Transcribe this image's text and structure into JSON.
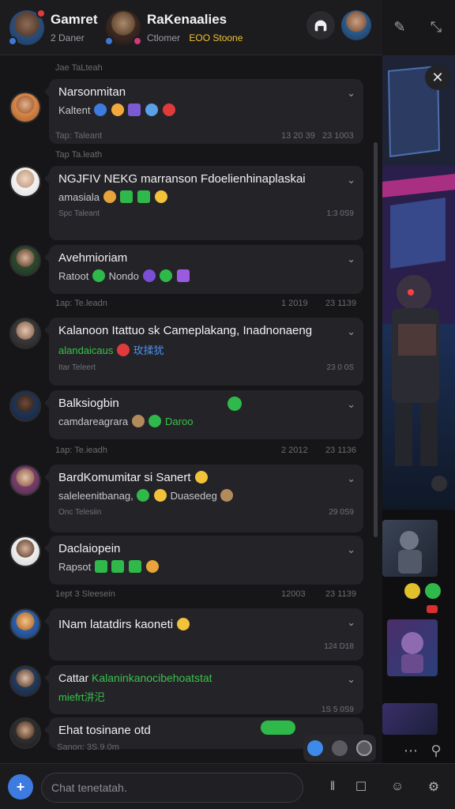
{
  "header": {
    "profile1": {
      "name": "Gamret",
      "sub": "2 Daner"
    },
    "profile2": {
      "name": "RaKenaalies",
      "sub": "Ctlomer",
      "highlight": "ЕОО Stoone"
    }
  },
  "messages": [
    {
      "title": "Narsonmitan",
      "line": "Kaltent",
      "meta_left": "",
      "meta_right": ""
    },
    {
      "title": "NGJFIV NEKG marranson Fdoelienhinaplaskai",
      "line": "amasiala",
      "meta_left": "Spc Taleant",
      "meta_right": "1:3 0S9"
    },
    {
      "title": "Avehmioriam",
      "line": "Ratoot",
      "line_suffix": "Nondo",
      "meta_left": "",
      "meta_right": ""
    },
    {
      "title": "Kalanoon Itattuo sk Cameplakang, Inadnonaeng",
      "line": "alandaicaus",
      "line_suffix": "玫揉犹",
      "meta_left": "Itar Teleert",
      "meta_right": "23 0 0S"
    },
    {
      "title": "Balksiogbin",
      "line": "camdareagrara",
      "line_suffix": "Daroo",
      "meta_left": "",
      "meta_right": ""
    },
    {
      "title": "BardKomumitar si Sanert",
      "line": "saleleenitbanag,",
      "line_suffix": "Duasedeg",
      "meta_left": "Onc Telesiin",
      "meta_right": "29 0S9"
    },
    {
      "title": "Daclaiopein",
      "line": "Rapsot",
      "meta_left": "",
      "meta_right": ""
    },
    {
      "title": "INam latatdirs kaoneti",
      "line": "",
      "meta_left": "",
      "meta_right": "124 D18"
    },
    {
      "title": "Cattar",
      "title_suffix": "Kalaninkanocibehoatstat",
      "line": "miefrt汫汜",
      "meta_left": "",
      "meta_right": "1S 5 0S9"
    },
    {
      "title": "Ehat tosinane otd",
      "line": "",
      "meta_left": "Sanon: 3S.9.0m",
      "meta_right": ""
    }
  ],
  "separators": [
    "Jae TaLteah",
    "Tap: Taleant",
    "13 20 39",
    "23 1003",
    "Tap Ta.leath",
    "1ap: Te.leadn",
    "1 2019",
    "23 1139",
    "1ap: Te.ieadh",
    "2 2012",
    "23 1136",
    "1ept 3 Sleesein",
    "12003",
    "23 1139"
  ],
  "composer": {
    "placeholder": "Chat tenetatah."
  }
}
